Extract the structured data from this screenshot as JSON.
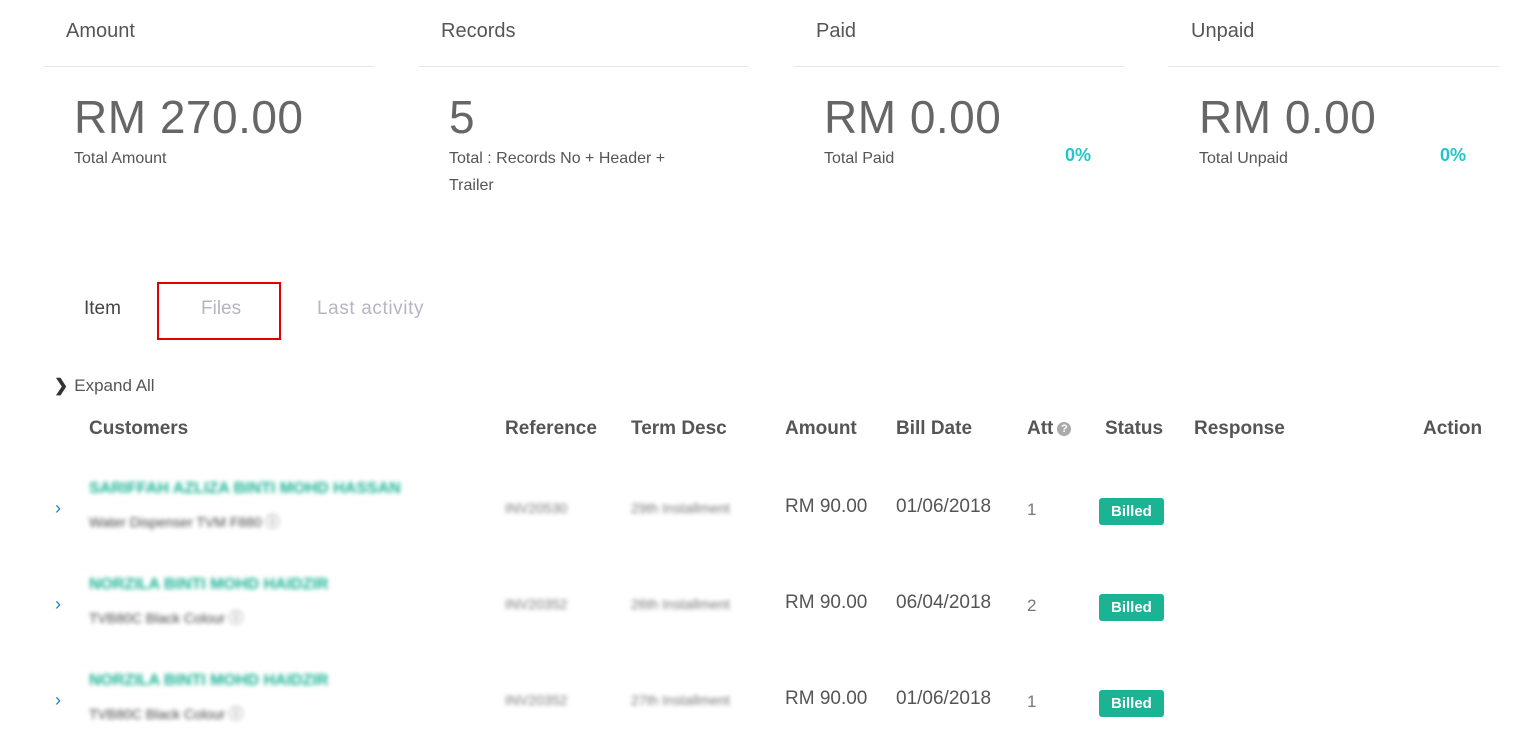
{
  "cards": [
    {
      "title": "Amount",
      "value": "RM 270.00",
      "label": "Total Amount",
      "pct": ""
    },
    {
      "title": "Records",
      "value": "5",
      "label": "Total : Records No + Header + Trailer",
      "pct": ""
    },
    {
      "title": "Paid",
      "value": "RM 0.00",
      "label": "Total Paid",
      "pct": "0%"
    },
    {
      "title": "Unpaid",
      "value": "RM 0.00",
      "label": "Total Unpaid",
      "pct": "0%"
    }
  ],
  "tabs": {
    "item": "Item",
    "files": "Files",
    "last_activity": "Last activity"
  },
  "expand_all": "Expand All",
  "columns": {
    "customers": "Customers",
    "reference": "Reference",
    "term_desc": "Term Desc",
    "amount": "Amount",
    "bill_date": "Bill Date",
    "att": "Att",
    "status": "Status",
    "response": "Response",
    "action": "Action"
  },
  "rows": [
    {
      "customer": "SARIFFAH AZLIZA BINTI MOHD HASSAN",
      "item": "Water Dispenser TVM F880 ⓘ",
      "reference": "INV20530",
      "term": "29th Installment",
      "amount": "RM 90.00",
      "bill_date": "01/06/2018",
      "att": "1",
      "status": "Billed"
    },
    {
      "customer": "NORZILA BINTI MOHD HAIDZIR",
      "item": "TVB80C Black Colour ⓘ",
      "reference": "INV20352",
      "term": "26th Installment",
      "amount": "RM 90.00",
      "bill_date": "06/04/2018",
      "att": "2",
      "status": "Billed"
    },
    {
      "customer": "NORZILA BINTI MOHD HAIDZIR",
      "item": "TVB80C Black Colour ⓘ",
      "reference": "INV20352",
      "term": "27th Installment",
      "amount": "RM 90.00",
      "bill_date": "01/06/2018",
      "att": "1",
      "status": "Billed"
    }
  ]
}
